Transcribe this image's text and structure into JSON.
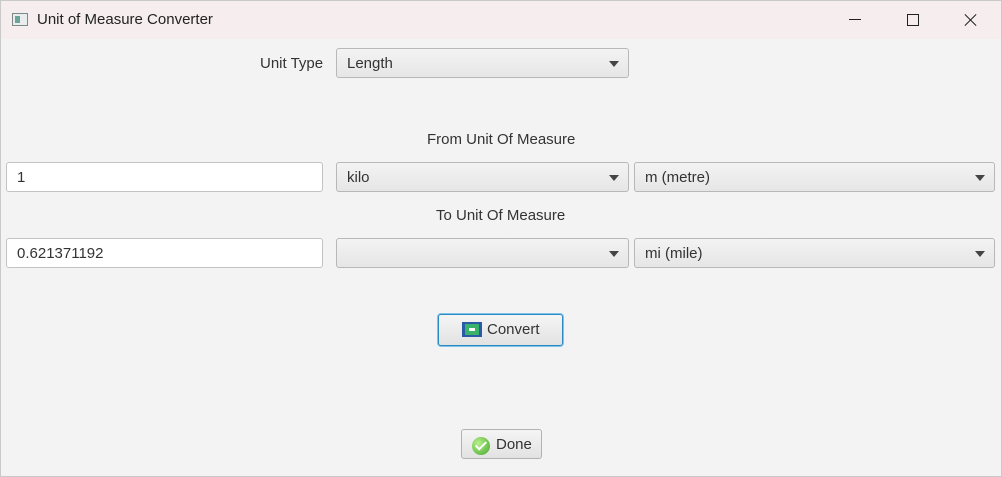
{
  "window": {
    "title": "Unit of Measure Converter"
  },
  "unit_type": {
    "label": "Unit Type",
    "selected": "Length"
  },
  "from": {
    "heading": "From Unit Of Measure",
    "value": "1",
    "prefix": "kilo",
    "unit": "m (metre)"
  },
  "to": {
    "heading": "To Unit Of Measure",
    "value": "0.621371192",
    "prefix": "",
    "unit": "mi (mile)"
  },
  "buttons": {
    "convert": "Convert",
    "done": "Done"
  },
  "colors": {
    "focus": "#2a8ac4",
    "titlebar": "#f6eeee",
    "background": "#f3f3f3"
  }
}
